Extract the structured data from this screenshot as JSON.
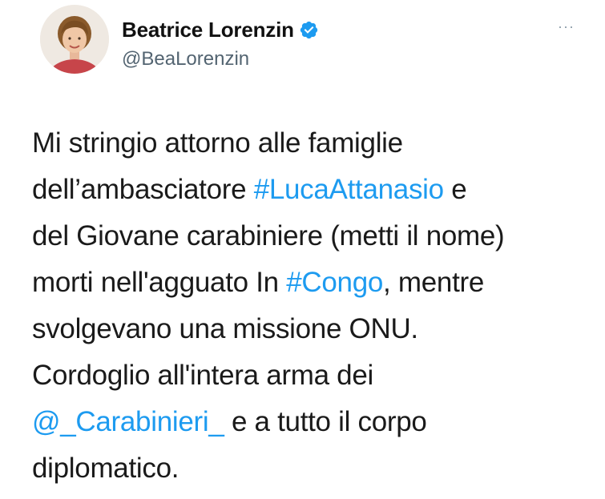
{
  "author": {
    "display_name": "Beatrice Lorenzin",
    "handle": "@BeaLorenzin",
    "verified": true,
    "avatar_icon": "profile-photo"
  },
  "more_icon": "ellipsis-icon",
  "more_glyph": "···",
  "colors": {
    "link": "#1d9bf0",
    "verified_badge": "#1d9bf0",
    "handle": "#536471",
    "text": "#1a1a1a"
  },
  "tweet": {
    "lines": [
      [
        {
          "text": "Mi stringio attorno alle famiglie"
        }
      ],
      [
        {
          "text": "dell’ambasciatore "
        },
        {
          "text": "#LucaAttanasio",
          "link": true
        },
        {
          "text": " e"
        }
      ],
      [
        {
          "text": "del Giovane carabiniere (metti il nome)"
        }
      ],
      [
        {
          "text": "morti nell'agguato In "
        },
        {
          "text": "#Congo",
          "link": true
        },
        {
          "text": ", mentre"
        }
      ],
      [
        {
          "text": "svolgevano una missione ONU."
        }
      ],
      [
        {
          "text": "Cordoglio all'intera arma dei"
        }
      ],
      [
        {
          "text": "@_Carabinieri_",
          "link": true
        },
        {
          "text": "  e a tutto il corpo"
        }
      ],
      [
        {
          "text": "diplomatico."
        }
      ]
    ]
  }
}
